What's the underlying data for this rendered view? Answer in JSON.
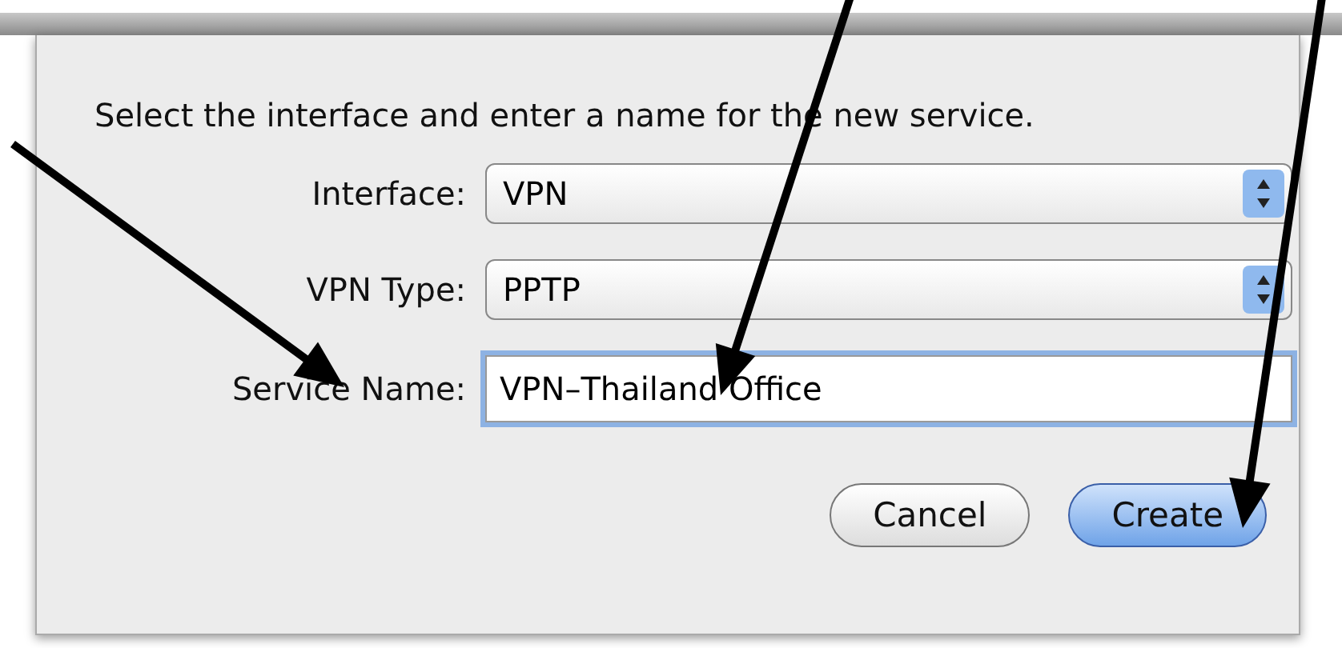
{
  "sheet": {
    "prompt": "Select the interface and enter a name for the new service.",
    "fields": [
      {
        "kind": "popup",
        "label": "Interface:",
        "value": "VPN"
      },
      {
        "kind": "popup",
        "label": "VPN Type:",
        "value": "PPTP"
      },
      {
        "kind": "text",
        "label": "Service Name:",
        "value": "VPN–Thailand Office",
        "focused": true
      }
    ],
    "buttons": [
      {
        "label": "Cancel",
        "default": false
      },
      {
        "label": "Create",
        "default": true
      }
    ]
  }
}
